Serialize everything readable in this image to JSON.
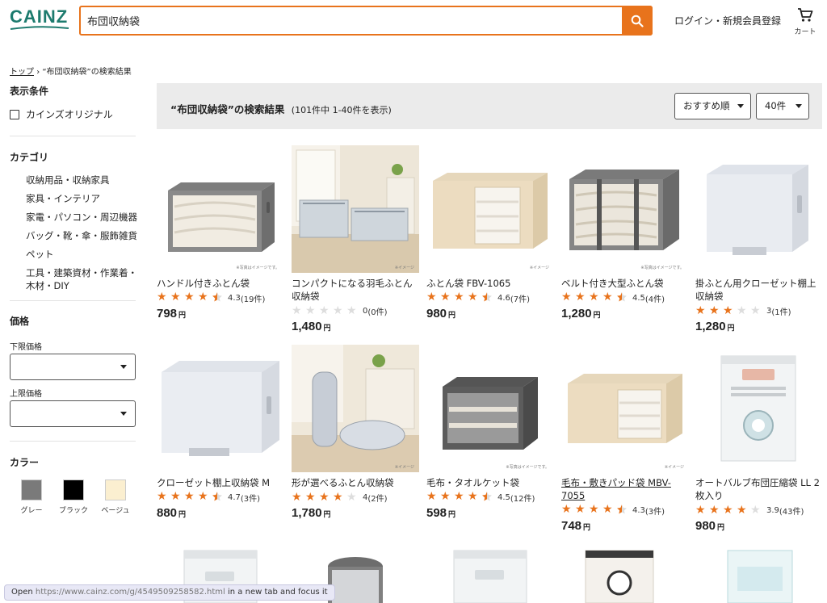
{
  "header": {
    "logo": "CAINZ",
    "search_value": "布団収納袋",
    "login_label": "ログイン・新規会員登録",
    "cart_label": "カート"
  },
  "breadcrumb": {
    "home": "トップ",
    "current": "“布団収納袋”の検索結果"
  },
  "sidebar": {
    "display_heading": "表示条件",
    "original_label": "カインズオリジナル",
    "category_heading": "カテゴリ",
    "categories": [
      "収納用品・収納家具",
      "家具・インテリア",
      "家電・パソコン・周辺機器",
      "バッグ・靴・傘・服飾雑貨",
      "ペット",
      "工具・建築資材・作業着・木材・DIY"
    ],
    "price_heading": "価格",
    "min_price_label": "下限価格",
    "max_price_label": "上限価格",
    "color_heading": "カラー",
    "colors": [
      {
        "label": "グレー",
        "hex": "#7a7a7a"
      },
      {
        "label": "ブラック",
        "hex": "#000000"
      },
      {
        "label": "ベージュ",
        "hex": "#fbefd0"
      }
    ]
  },
  "results": {
    "title": "“布団収納袋”の検索結果",
    "count": "(101件中 1-40件を表示)",
    "sort_label": "おすすめ順",
    "per_page_label": "40件"
  },
  "image_note": "※写真はイメージです。",
  "image_note_short": "※イメージ",
  "products": [
    {
      "name": "ハンドル付きふとん袋",
      "stars": 4.5,
      "rating": "4.3",
      "reviews": "(19件)",
      "price": "798",
      "unit": "円"
    },
    {
      "name": "コンパクトになる羽毛ふとん収納袋",
      "stars": 0,
      "rating": "0",
      "reviews": "(0件)",
      "price": "1,480",
      "unit": "円"
    },
    {
      "name": "ふとん袋 FBV-1065",
      "stars": 4.5,
      "rating": "4.6",
      "reviews": "(7件)",
      "price": "980",
      "unit": "円"
    },
    {
      "name": "ベルト付き大型ふとん袋",
      "stars": 4.5,
      "rating": "4.5",
      "reviews": "(4件)",
      "price": "1,280",
      "unit": "円"
    },
    {
      "name": "掛ふとん用クローゼット棚上収納袋",
      "stars": 3,
      "rating": "3",
      "reviews": "(1件)",
      "price": "1,280",
      "unit": "円"
    },
    {
      "name": "クローゼット棚上収納袋 M",
      "stars": 4.5,
      "rating": "4.7",
      "reviews": "(3件)",
      "price": "880",
      "unit": "円"
    },
    {
      "name": "形が選べるふとん収納袋",
      "stars": 4,
      "rating": "4",
      "reviews": "(2件)",
      "price": "1,780",
      "unit": "円"
    },
    {
      "name": "毛布・タオルケット袋",
      "stars": 4.5,
      "rating": "4.5",
      "reviews": "(12件)",
      "price": "598",
      "unit": "円"
    },
    {
      "name": "毛布・敷きパッド袋 MBV-7055",
      "stars": 4.5,
      "rating": "4.3",
      "reviews": "(3件)",
      "price": "748",
      "unit": "円"
    },
    {
      "name": "オートバルブ布団圧縮袋 LL 2枚入り",
      "stars": 4,
      "rating": "3.9",
      "reviews": "(43件)",
      "price": "980",
      "unit": "円"
    }
  ],
  "status": {
    "prefix": "Open",
    "url": "https://www.cainz.com/g/4549509258582.html",
    "suffix": "in a new tab and focus it"
  }
}
